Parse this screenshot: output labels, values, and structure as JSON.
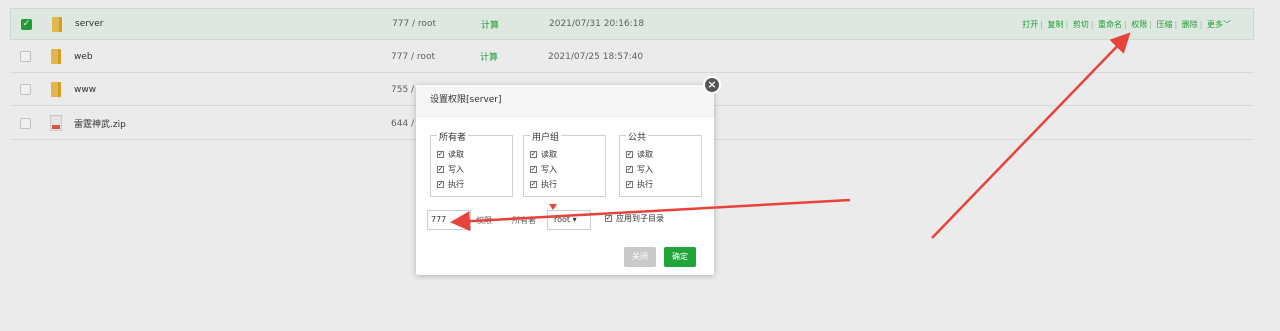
{
  "files": [
    {
      "name": "server",
      "perm": "777 / root",
      "type": "计算",
      "time": "2021/07/31 20:16:18",
      "checked": true,
      "kind": "folder"
    },
    {
      "name": "web",
      "perm": "777 / root",
      "type": "计算",
      "time": "2021/07/25 18:57:40",
      "checked": false,
      "kind": "folder"
    },
    {
      "name": "www",
      "perm": "755 /",
      "type": "",
      "time": "",
      "checked": false,
      "kind": "folder"
    },
    {
      "name": "雷霆神武.zip",
      "perm": "644 /",
      "type": "",
      "time": "",
      "checked": false,
      "kind": "zip"
    }
  ],
  "ops": [
    "打开",
    "复制",
    "剪切",
    "重命名",
    "权限",
    "压缩",
    "删除",
    "更多"
  ],
  "dialog": {
    "title": "设置权限[server]",
    "groups": [
      {
        "label": "所有者",
        "options": [
          "读取",
          "写入",
          "执行"
        ]
      },
      {
        "label": "用户组",
        "options": [
          "读取",
          "写入",
          "执行"
        ]
      },
      {
        "label": "公共",
        "options": [
          "读取",
          "写入",
          "执行"
        ]
      }
    ],
    "perm_value": "777",
    "perm_label": "权限",
    "owner_label": "所有者",
    "owner_value": "root",
    "apply_label": "应用到子目录",
    "close_label": "关闭",
    "ok_label": "确定"
  },
  "colors": {
    "accent": "#20a53a",
    "arrow": "#e8423a"
  }
}
